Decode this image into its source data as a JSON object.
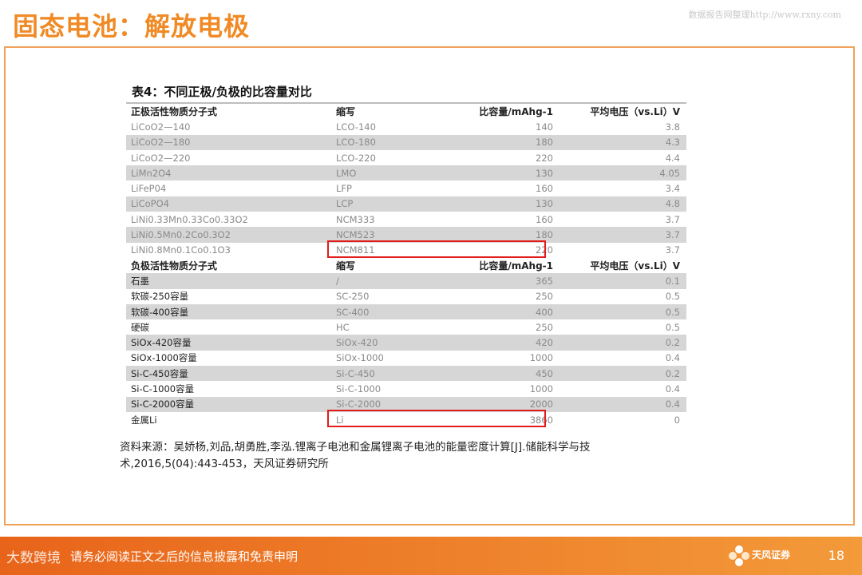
{
  "header": {
    "title": "固态电池：解放电极",
    "watermark": "数据报告网整理http://www.rxny.com"
  },
  "table": {
    "title": "表4：不同正极/负极的比容量对比",
    "cathode_headers": [
      "正极活性物质分子式",
      "缩写",
      "比容量/mAhg-1",
      "平均电压（vs.Li）V"
    ],
    "cathode_rows": [
      [
        "LiCoO2—140",
        "LCO-140",
        "140",
        "3.8"
      ],
      [
        "LiCoO2—180",
        "LCO-180",
        "180",
        "4.3"
      ],
      [
        "LiCoO2—220",
        "LCO-220",
        "220",
        "4.4"
      ],
      [
        "LiMn2O4",
        "LMO",
        "130",
        "4.05"
      ],
      [
        "LiFeP04",
        "LFP",
        "160",
        "3.4"
      ],
      [
        "LiCoPO4",
        "LCP",
        "130",
        "4.8"
      ],
      [
        "LiNi0.33Mn0.33Co0.33O2",
        "NCM333",
        "160",
        "3.7"
      ],
      [
        "LiNi0.5Mn0.2Co0.3O2",
        "NCM523",
        "180",
        "3.7"
      ],
      [
        "LiNi0.8Mn0.1Co0.1O3",
        "NCM811",
        "220",
        "3.7"
      ]
    ],
    "anode_headers": [
      "负极活性物质分子式",
      "缩写",
      "比容量/mAhg-1",
      "平均电压（vs.Li）V"
    ],
    "anode_rows": [
      [
        "石墨",
        "/",
        "365",
        "0.1"
      ],
      [
        "软碳-250容量",
        "SC-250",
        "250",
        "0.5"
      ],
      [
        "软碳-400容量",
        "SC-400",
        "400",
        "0.5"
      ],
      [
        "硬碳",
        "HC",
        "250",
        "0.5"
      ],
      [
        "SiOx-420容量",
        "SiOx-420",
        "420",
        "0.2"
      ],
      [
        "SiOx-1000容量",
        "SiOx-1000",
        "1000",
        "0.4"
      ],
      [
        "Si-C-450容量",
        "Si-C-450",
        "450",
        "0.2"
      ],
      [
        "Si-C-1000容量",
        "Si-C-1000",
        "1000",
        "0.4"
      ],
      [
        "Si-C-2000容量",
        "Si-C-2000",
        "2000",
        "0.4"
      ],
      [
        "金属Li",
        "Li",
        "3860",
        "0"
      ]
    ]
  },
  "source": "资料来源：吴娇杨,刘品,胡勇胜,李泓.锂离子电池和金属锂离子电池的能量密度计算[J].储能科学与技术,2016,5(04):443-453，天风证券研究所",
  "footer": {
    "notice": "请务必阅读正文之后的信息披露和免责申明",
    "brand": "大数跨境",
    "logo_text": "天风证券",
    "page_number": "18"
  },
  "colors": {
    "accent": "#f08a24",
    "highlight": "#e31b1b",
    "row_shade": "#d6d6d6"
  }
}
